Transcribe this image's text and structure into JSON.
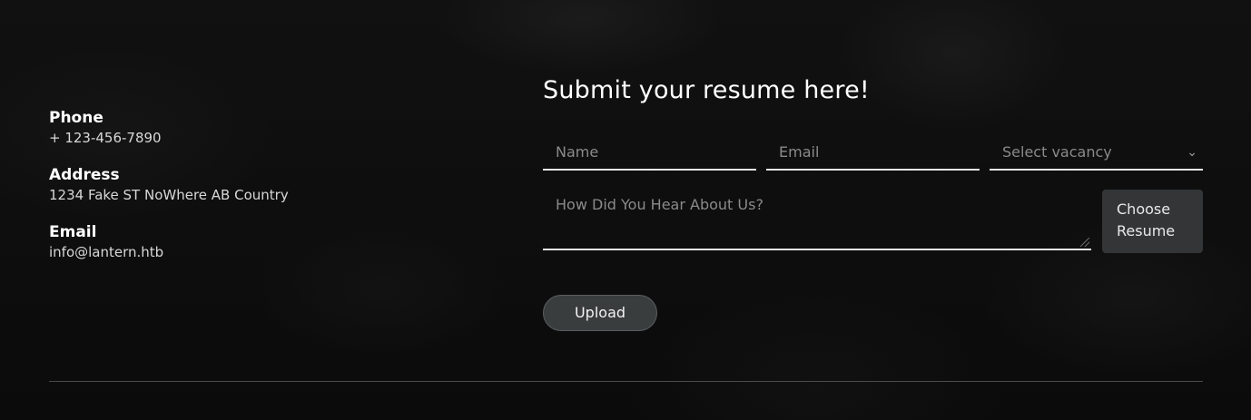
{
  "contact": {
    "phone": {
      "label": "Phone",
      "value": "+ 123-456-7890"
    },
    "address": {
      "label": "Address",
      "value": "1234 Fake ST NoWhere AB Country"
    },
    "email": {
      "label": "Email",
      "value": "info@lantern.htb"
    }
  },
  "form": {
    "title": "Submit your resume here!",
    "name_placeholder": "Name",
    "email_placeholder": "Email",
    "vacancy_placeholder": "Select vacancy",
    "vacancy_icon": "chevron-down-icon",
    "heard_placeholder": "How Did You Hear About Us?",
    "choose_resume_label": "Choose Resume",
    "upload_label": "Upload"
  }
}
